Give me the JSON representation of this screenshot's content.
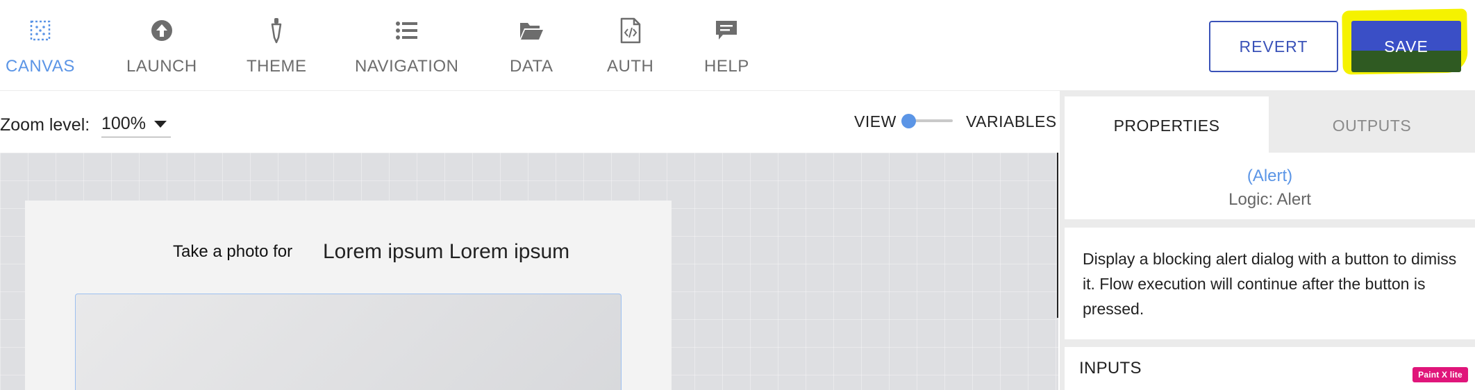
{
  "nav": {
    "items": [
      {
        "label": "CANVAS",
        "icon": "canvas-grid-icon",
        "active": true
      },
      {
        "label": "LAUNCH",
        "icon": "arrow-up-circle-icon"
      },
      {
        "label": "THEME",
        "icon": "dropper-icon"
      },
      {
        "label": "NAVIGATION",
        "icon": "list-icon"
      },
      {
        "label": "DATA",
        "icon": "folder-open-icon"
      },
      {
        "label": "AUTH",
        "icon": "code-file-icon"
      },
      {
        "label": "HELP",
        "icon": "chat-bubble-icon"
      }
    ]
  },
  "actions": {
    "revert_label": "REVERT",
    "save_label": "SAVE"
  },
  "toolbar": {
    "zoom_label": "Zoom level:",
    "zoom_value": "100%",
    "toggle_left": "VIEW",
    "toggle_right": "VARIABLES"
  },
  "canvas": {
    "photo_prompt": "Take a photo for",
    "photo_target": "Lorem ipsum Lorem ipsum"
  },
  "panel": {
    "tabs": [
      {
        "label": "PROPERTIES",
        "active": true
      },
      {
        "label": "OUTPUTS",
        "active": false
      }
    ],
    "node_name": "(Alert)",
    "node_type": "Logic: Alert",
    "description": "Display a blocking alert dialog with a button to dimiss it. Flow execution will continue after the button is pressed.",
    "inputs_title": "INPUTS"
  },
  "watermark": "Paint X lite",
  "colors": {
    "accent": "#5b95e6",
    "primary_button": "#3a4fc6",
    "highlight": "#f5f200"
  }
}
